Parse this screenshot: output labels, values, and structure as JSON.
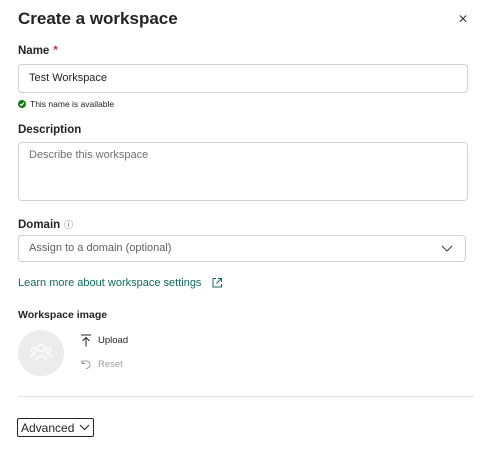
{
  "dialog": {
    "title": "Create a workspace",
    "close_icon": "close-icon"
  },
  "name_field": {
    "label": "Name",
    "required_marker": "*",
    "value": "Test Workspace",
    "status": "This name is available",
    "status_color": "#107c10"
  },
  "description_field": {
    "label": "Description",
    "placeholder": "Describe this workspace"
  },
  "domain_field": {
    "label": "Domain",
    "info_icon": "info-icon",
    "selected": "Assign to a domain (optional)"
  },
  "learn_more": {
    "text": "Learn more about workspace settings",
    "icon": "external-link-icon",
    "color": "#0f6c5f"
  },
  "workspace_image": {
    "label": "Workspace image",
    "upload_label": "Upload",
    "reset_label": "Reset"
  },
  "advanced": {
    "label": "Advanced"
  }
}
